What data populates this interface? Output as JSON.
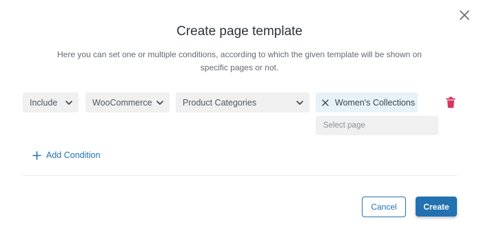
{
  "dialog": {
    "title": "Create page template",
    "description": "Here you can set one or multiple conditions, according to which the given template will be shown on specific pages or not."
  },
  "condition": {
    "include_select": "Include",
    "source_select": "WooCommerce",
    "type_select": "Product Categories",
    "selected_chip": "Women's Collections",
    "page_select_placeholder": "Select page"
  },
  "actions": {
    "add_condition": "Add Condition",
    "cancel": "Cancel",
    "create": "Create"
  },
  "colors": {
    "accent": "#2271b1",
    "delete": "#d63660",
    "chip_bg": "#e7f2f8",
    "field_bg": "#f0f0f1"
  },
  "icons": {
    "close": "close-icon",
    "chevron": "chevron-down-icon",
    "remove_chip": "remove-chip-icon",
    "delete": "trash-icon",
    "add": "plus-icon"
  }
}
